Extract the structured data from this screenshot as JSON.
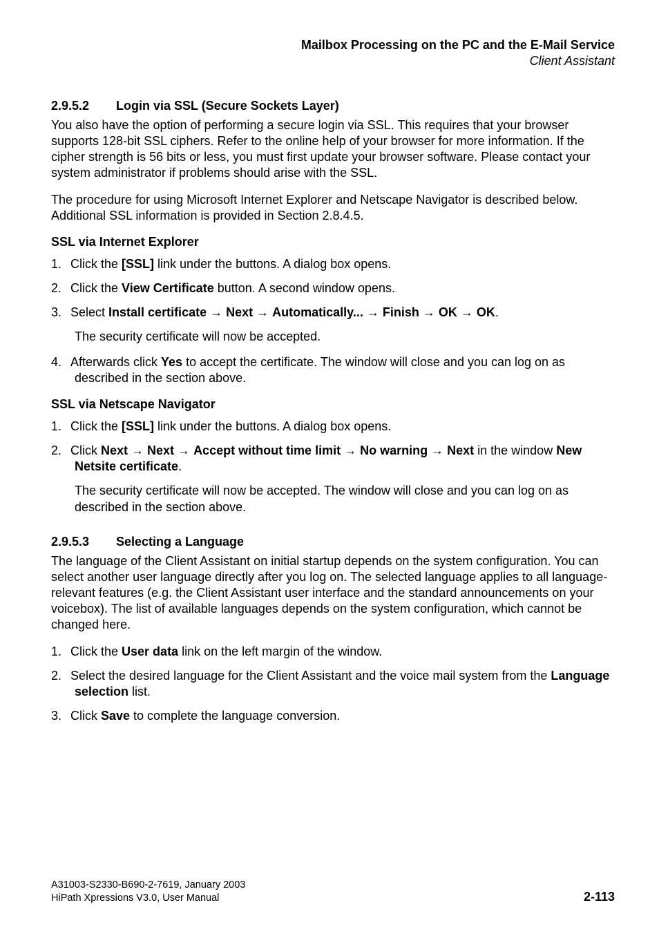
{
  "running_head": {
    "title": "Mailbox Processing on the PC and the E-Mail Service",
    "subtitle": "Client Assistant"
  },
  "section_2952": {
    "number": "2.9.5.2",
    "title": "Login via SSL (Secure Sockets Layer)",
    "para1": "You also have the option of performing a secure login via SSL. This requires that your browser supports 128-bit SSL ciphers. Refer to the online help of your browser for more information. If the cipher strength is 56 bits or less, you must first update your browser software. Please contact your system administrator if problems should arise with the SSL.",
    "para2": "The procedure for using Microsoft Internet Explorer and Netscape Navigator is described below. Additional SSL information is provided in Section 2.8.4.5."
  },
  "ssl_ie": {
    "heading": "SSL via Internet Explorer",
    "items": {
      "n1": "1.",
      "i1a": "Click the ",
      "i1b": "[SSL]",
      "i1c": " link under the buttons. A dialog box opens.",
      "n2": "2.",
      "i2a": "Click the ",
      "i2b": "View Certificate",
      "i2c": " button. A second window opens.",
      "n3": "3.",
      "i3a": "Select ",
      "i3b": "Install certificate",
      "i3arr1": " → ",
      "i3c": "Next",
      "i3arr2": " → ",
      "i3d": "Automatically...",
      "i3arr3": " → ",
      "i3e": "Finish",
      "i3arr4": " → ",
      "i3f": "OK",
      "i3arr5": " → ",
      "i3g": "OK",
      "i3end": ".",
      "i3sub": "The security certificate will now be accepted.",
      "n4": "4.",
      "i4a": "Afterwards click ",
      "i4b": "Yes",
      "i4c": " to accept the certificate. The window will close and you can log on as described in the section above."
    }
  },
  "ssl_nn": {
    "heading": "SSL via Netscape Navigator",
    "items": {
      "n1": "1.",
      "i1a": "Click the ",
      "i1b": "[SSL]",
      "i1c": " link under the buttons. A dialog box opens.",
      "n2": "2.",
      "i2a": "Click ",
      "i2b": "Next",
      "i2arr1": " → ",
      "i2c": "Next",
      "i2arr2": " → ",
      "i2d": "Accept without time limit",
      "i2arr3": " → ",
      "i2e": "No warning",
      "i2arr4": " → ",
      "i2f": "Next",
      "i2mid": " in the window ",
      "i2g": "New Netsite certificate",
      "i2end": ".",
      "i2sub": "The security certificate will now be accepted. The window will close and you can log on as described in the section above."
    }
  },
  "section_2953": {
    "number": "2.9.5.3",
    "title": "Selecting a Language",
    "para1": "The language of the Client Assistant on initial startup depends on the system configuration. You can select another user language directly after you log on. The selected language applies to all language-relevant features (e.g. the Client Assistant user interface and the standard announcements on your voicebox). The list of available languages depends on the system configuration, which cannot be changed here.",
    "items": {
      "n1": "1.",
      "i1a": "Click the ",
      "i1b": "User data",
      "i1c": " link on the left margin of the window.",
      "n2": "2.",
      "i2a": "Select the desired language for the Client Assistant and the voice mail system from the ",
      "i2b": "Language selection",
      "i2c": " list.",
      "n3": "3.",
      "i3a": "Click ",
      "i3b": "Save",
      "i3c": " to complete the language conversion."
    }
  },
  "footer": {
    "line1": "A31003-S2330-B690-2-7619, January 2003",
    "line2": "HiPath Xpressions V3.0, User Manual",
    "page": "2-113"
  }
}
